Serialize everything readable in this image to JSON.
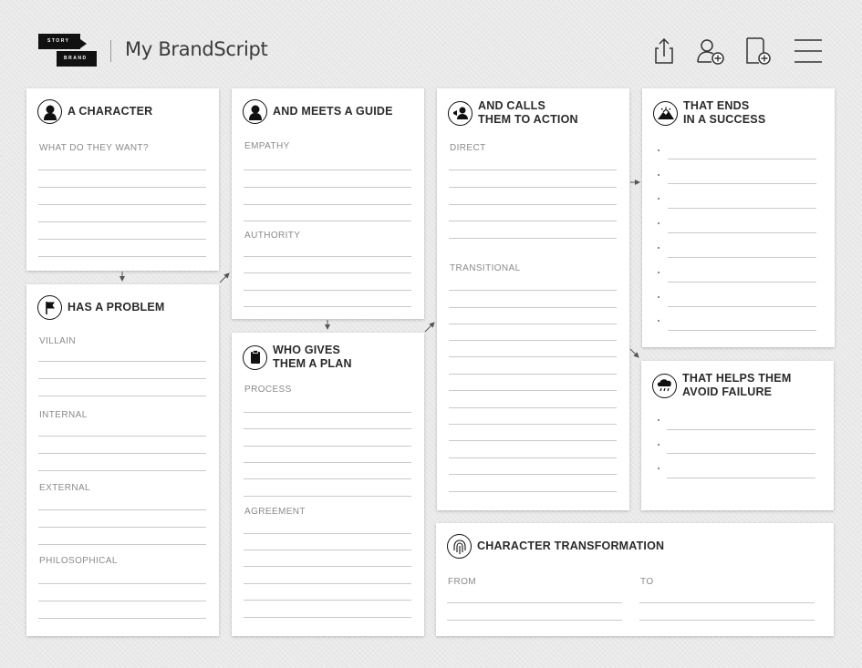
{
  "logo": {
    "top_word": "STORY",
    "bottom_word": "BRAND"
  },
  "app": {
    "title": "My BrandScript"
  },
  "header": {
    "icons": [
      "share-icon",
      "add-user-icon",
      "add-document-icon",
      "menu-icon"
    ]
  },
  "cards": {
    "character": {
      "title": "A CHARACTER",
      "section_label": "WHAT DO THEY WANT?"
    },
    "guide": {
      "title": "AND MEETS A GUIDE",
      "empathy_label": "EMPATHY",
      "authority_label": "AUTHORITY"
    },
    "action": {
      "title": "AND CALLS\nTHEM TO ACTION",
      "direct_label": "DIRECT",
      "transitional_label": "TRANSITIONAL"
    },
    "success": {
      "title": "THAT ENDS\nIN A SUCCESS"
    },
    "problem": {
      "title": "HAS A PROBLEM",
      "villain_label": "VILLAIN",
      "internal_label": "INTERNAL",
      "external_label": "EXTERNAL",
      "philosophical_label": "PHILOSOPHICAL"
    },
    "plan": {
      "title": "WHO GIVES\nTHEM A PLAN",
      "process_label": "PROCESS",
      "agreement_label": "AGREEMENT"
    },
    "failure": {
      "title": "THAT HELPS THEM\nAVOID FAILURE"
    },
    "transformation": {
      "title": "CHARACTER TRANSFORMATION",
      "from_label": "FROM",
      "to_label": "TO"
    }
  }
}
